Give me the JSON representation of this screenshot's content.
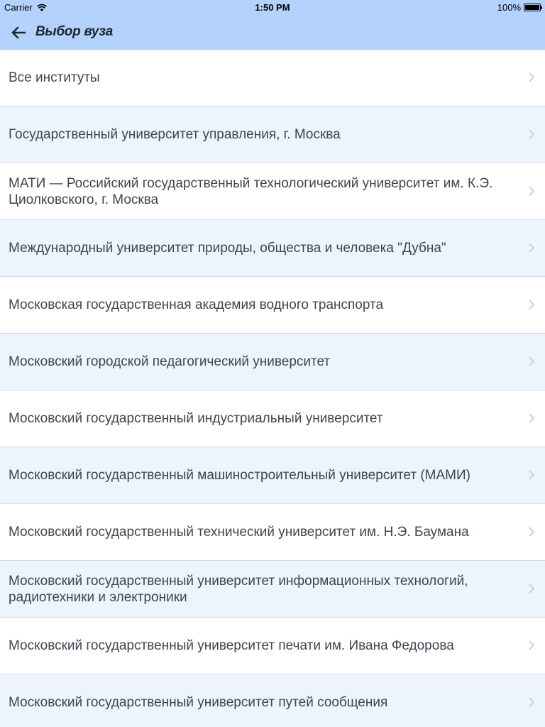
{
  "status_bar": {
    "carrier": "Carrier",
    "time": "1:50 PM",
    "battery": "100%"
  },
  "nav": {
    "title": "Выбор вуза",
    "back_icon": "arrow-left-icon"
  },
  "colors": {
    "header_bg": "#b3d2fd",
    "row_alt_bg": "#eef4fe",
    "text": "#3f4550"
  },
  "list": {
    "items": [
      {
        "label": "Все институты"
      },
      {
        "label": "Государственный университет управления, г. Москва"
      },
      {
        "label": "МАТИ — Российский государственный технологический университет им. К.Э. Циолковского, г. Москва"
      },
      {
        "label": "Международный университет природы, общества и человека \"Дубна\""
      },
      {
        "label": "Московская государственная академия водного транспорта"
      },
      {
        "label": "Московский городской педагогический университет"
      },
      {
        "label": "Московский государственный индустриальный университет"
      },
      {
        "label": "Московский государственный машиностроительный университет (МАМИ)"
      },
      {
        "label": "Московский государственный технический университет им. Н.Э. Баумана"
      },
      {
        "label": "Московский государственный университет информационных технологий, радиотехники и электроники"
      },
      {
        "label": "Московский государственный университет печати им. Ивана Федорова"
      },
      {
        "label": "Московский государственный университет путей сообщения"
      }
    ]
  }
}
